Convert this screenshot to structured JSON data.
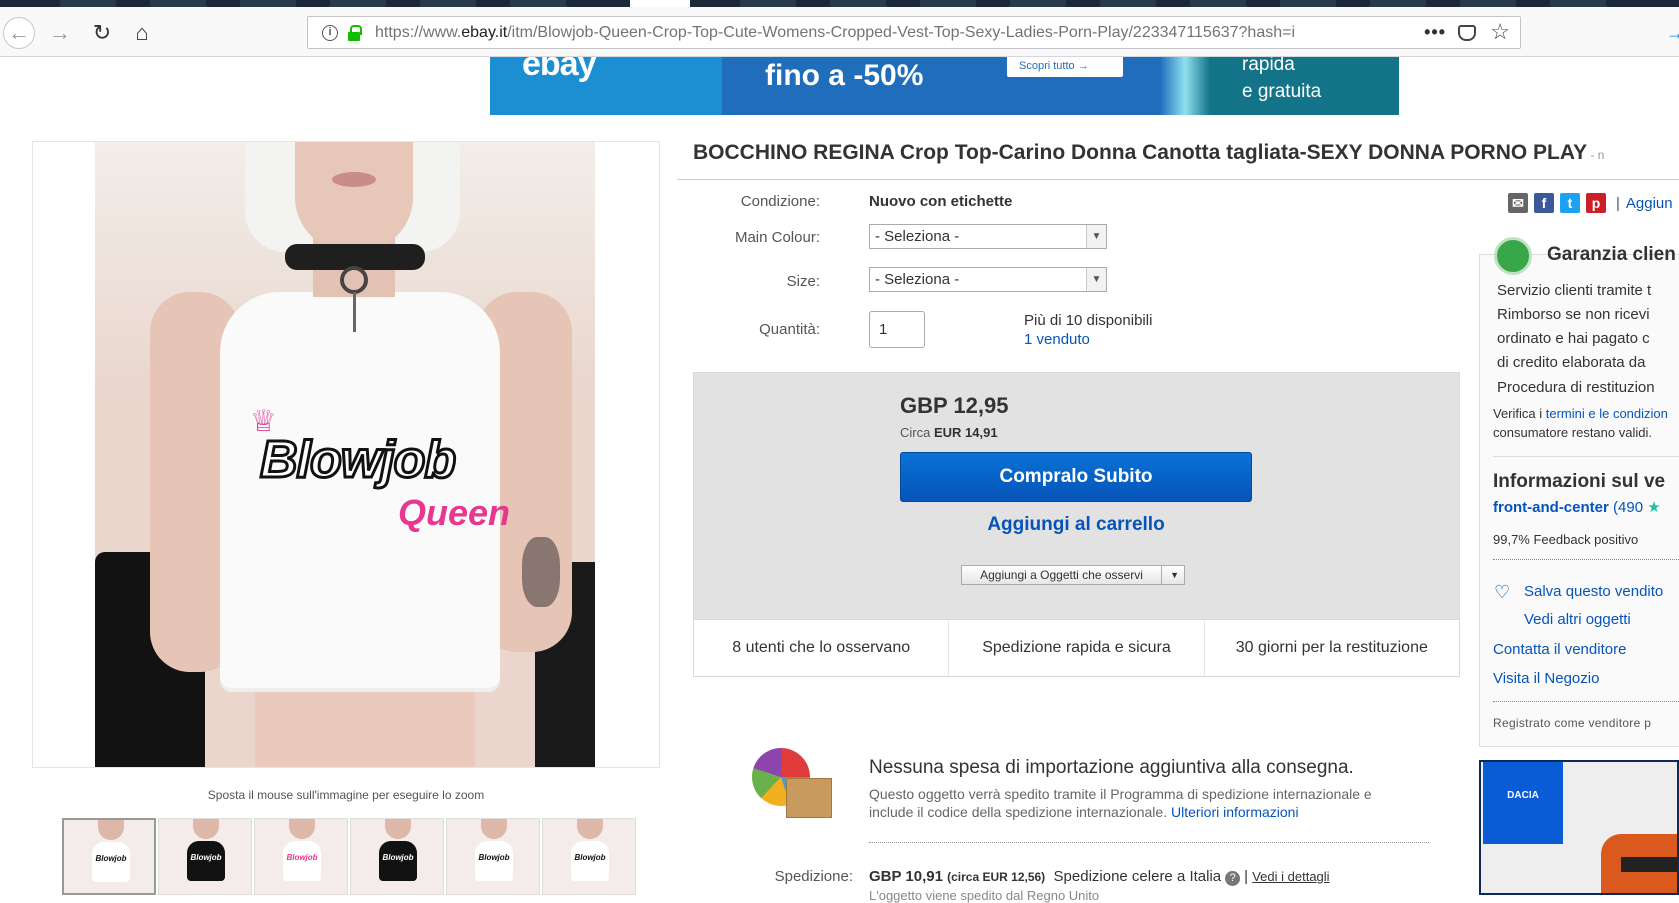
{
  "browser": {
    "url_prefix": "https://www.",
    "url_domain": "ebay.it",
    "url_rest": "/itm/Blowjob-Queen-Crop-Top-Cute-Womens-Cropped-Vest-Top-Sexy-Ladies-Porn-Play/223347115637?hash=i",
    "page_actions_icon": "•••"
  },
  "banner": {
    "logo_text": "ebay",
    "promo_text": "fino a -50%",
    "cta_label": "Scopri tutto →",
    "shipping_line1": "rapida",
    "shipping_line2": "e gratuita"
  },
  "gallery": {
    "shirt_text_1": "Blowjob",
    "shirt_text_2": "Queen",
    "zoom_hint": "Sposta il mouse sull'immagine per eseguire lo zoom",
    "thumbnails": [
      {
        "shirt_color": "#ffffff",
        "label_color": "#111111",
        "label": "Blowjob"
      },
      {
        "shirt_color": "#111111",
        "label_color": "#ffffff",
        "label": "Blowjob"
      },
      {
        "shirt_color": "#ffffff",
        "label_color": "#e6388f",
        "label": "Blowjob"
      },
      {
        "shirt_color": "#111111",
        "label_color": "#ffffff",
        "label": "Blowjob"
      },
      {
        "shirt_color": "#ffffff",
        "label_color": "#111111",
        "label": "Blowjob"
      },
      {
        "shirt_color": "#ffffff",
        "label_color": "#111111",
        "label": "Blowjob"
      }
    ]
  },
  "item": {
    "title": "BOCCHINO REGINA Crop Top-Carino Donna Canotta tagliata-SEXY DONNA PORNO PLAY",
    "title_suffix": " - n",
    "condition_label": "Condizione:",
    "condition_value": "Nuovo con etichette",
    "colour_label": "Main Colour:",
    "colour_value": "- Seleziona -",
    "size_label": "Size:",
    "size_value": "- Seleziona -",
    "qty_label": "Quantità:",
    "qty_value": "1",
    "available": "Più di 10 disponibili",
    "sold": "1 venduto"
  },
  "buybox": {
    "price": "GBP 12,95",
    "approx_prefix": "Circa ",
    "approx_value": "EUR 14,91",
    "buy_now": "Compralo Subito",
    "add_to_cart": "Aggiungi al carrello",
    "watch": "Aggiungi a Oggetti che osservi",
    "stats": [
      "8 utenti che lo osservano",
      "Spedizione rapida e sicura",
      "30 giorni per la restituzione"
    ]
  },
  "import": {
    "title": "Nessuna spesa di importazione aggiuntiva alla consegna.",
    "text": "Questo oggetto verrà spedito tramite il Programma di spedizione internazionale e include il codice della spedizione internazionale.",
    "link": "Ulteriori informazioni"
  },
  "shipping": {
    "label": "Spedizione:",
    "price": "GBP 10,91",
    "approx": "(circa EUR 12,56)",
    "method": "Spedizione celere a Italia",
    "separator": "|",
    "details_link": "Vedi i dettagli",
    "cut_line": "L'oggetto viene spedito dal Regno Unito"
  },
  "sidebar": {
    "share_separator": "|",
    "share_add": "Aggiun",
    "guarantee_title": "Garanzia clien",
    "guarantee_items": [
      "Servizio clienti tramite t",
      "Rimborso se non ricevi",
      "ordinato e hai pagato c",
      "di credito elaborata da",
      "Procedura di restituzion"
    ],
    "verify_prefix": "Verifica i ",
    "verify_link": "termini e le condizion",
    "verify_suffix": "consumatore restano validi.",
    "seller_heading": "Informazioni sul ve",
    "seller_name": "front-and-center",
    "seller_score": " (490 ",
    "seller_star": "★",
    "feedback": "99,7% Feedback positivo",
    "save_seller": "Salva questo vendito",
    "see_items": "Vedi altri oggetti",
    "contact": "Contatta il venditore",
    "visit_store": "Visita il Negozio",
    "registered": "Registrato come venditore p"
  },
  "ad": {
    "brand": "DACIA"
  }
}
